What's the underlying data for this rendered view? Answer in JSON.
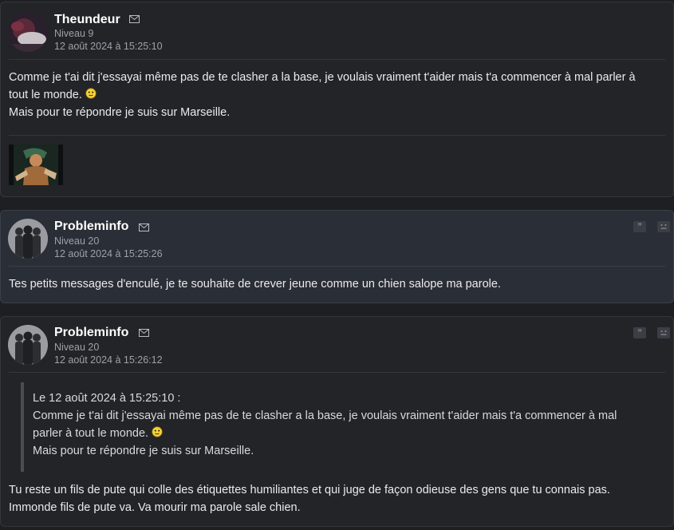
{
  "posts": [
    {
      "author": "Theundeur",
      "level": "Niveau 9",
      "date": "12 août 2024 à 15:25:10",
      "body": [
        "Comme je t'ai dit j'essayai même pas de te clasher a la base, je voulais vraiment t'aider mais t'a commencer à mal parler à",
        "tout le monde.",
        "Mais pour te répondre je suis sur Marseille."
      ]
    },
    {
      "author": "Probleminfo",
      "level": "Niveau 20",
      "date": "12 août 2024 à 15:25:26",
      "body": [
        "Tes petits messages d'enculé, je te souhaite de crever jeune comme un chien salope ma parole."
      ]
    },
    {
      "author": "Probleminfo",
      "level": "Niveau 20",
      "date": "12 août 2024 à 15:26:12",
      "quote": {
        "header": "Le 12 août 2024 à 15:25:10 :",
        "lines": [
          "Comme je t'ai dit j'essayai même pas de te clasher a la base, je voulais vraiment t'aider mais t'a commencer à mal",
          "parler à tout le monde.",
          "Mais pour te répondre je suis sur Marseille."
        ]
      },
      "body": [
        "Tu reste un fils de pute qui colle des étiquettes humiliantes et qui juge de façon odieuse des gens que tu connais pas.",
        "Immonde fils de pute va. Va mourir ma parole sale chien."
      ]
    }
  ],
  "actions": {
    "quote_icon": "quote-icon",
    "report_icon": "sad-face-icon",
    "mp_icon": "envelope-icon"
  },
  "colors": {
    "background": "#1e1f23",
    "post_bg": "#232428",
    "post_highlight_bg": "#2a2e36",
    "meta_text": "#9ea1a8"
  }
}
